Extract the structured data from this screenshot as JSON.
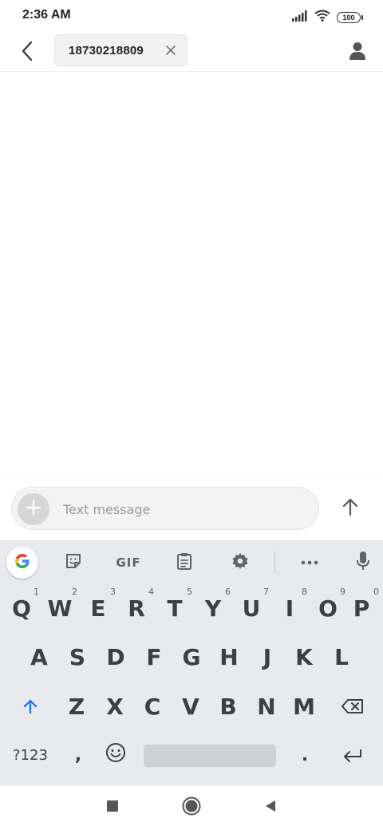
{
  "status_bar": {
    "time": "2:36 AM",
    "battery": "100",
    "icons": [
      "signal-icon",
      "wifi-icon",
      "battery-icon"
    ]
  },
  "header": {
    "back_icon": "chevron-left-icon",
    "recipient": "18730218809",
    "chip_close_icon": "close-icon",
    "contact_icon": "person-icon"
  },
  "compose": {
    "placeholder": "Text message",
    "value": "",
    "add_icon": "plus-icon",
    "send_icon": "arrow-up-icon"
  },
  "keyboard": {
    "toolbar": {
      "google_icon": "google-g-icon",
      "sticker_icon": "sticker-icon",
      "gif_label": "GIF",
      "clipboard_icon": "clipboard-icon",
      "settings_icon": "gear-icon",
      "more_icon": "more-horizontal-icon",
      "mic_icon": "microphone-icon"
    },
    "row1": [
      {
        "label": "Q",
        "hint": "1"
      },
      {
        "label": "W",
        "hint": "2"
      },
      {
        "label": "E",
        "hint": "3"
      },
      {
        "label": "R",
        "hint": "4"
      },
      {
        "label": "T",
        "hint": "5"
      },
      {
        "label": "Y",
        "hint": "6"
      },
      {
        "label": "U",
        "hint": "7"
      },
      {
        "label": "I",
        "hint": "8"
      },
      {
        "label": "O",
        "hint": "9"
      },
      {
        "label": "P",
        "hint": "0"
      }
    ],
    "row2": [
      "A",
      "S",
      "D",
      "F",
      "G",
      "H",
      "J",
      "K",
      "L"
    ],
    "row3": [
      "Z",
      "X",
      "C",
      "V",
      "B",
      "N",
      "M"
    ],
    "symbols_label": "?123",
    "comma": ",",
    "period": ".",
    "shift_icon": "shift-arrow-icon",
    "backspace_icon": "backspace-icon",
    "emoji_icon": "emoji-icon",
    "enter_icon": "enter-icon",
    "accent_color": "#1a73e8",
    "key_color": "#3c4043",
    "background_color": "#e8eaed"
  },
  "nav_bar": {
    "icons": [
      "square-recents-icon",
      "circle-home-icon",
      "triangle-back-icon"
    ]
  }
}
